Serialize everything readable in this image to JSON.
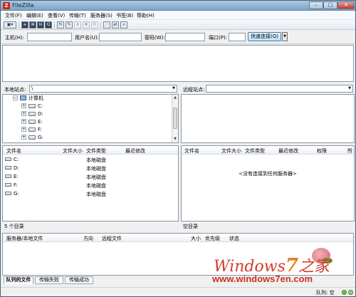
{
  "window": {
    "title": "FileZilla",
    "min": "–",
    "max": "□",
    "close": "✕",
    "app_icon": "Z"
  },
  "menu": [
    "文件(F)",
    "编辑(E)",
    "查看(V)",
    "传输(T)",
    "服务器(S)",
    "书签(B)",
    "帮助(H)"
  ],
  "toolbar": {
    "icons": [
      "site-manager-icon",
      "toggle-log-icon",
      "toggle-tree-local-icon",
      "toggle-tree-remote-icon",
      "toggle-queue-icon",
      "refresh-icon",
      "process-queue-icon",
      "cancel-icon",
      "disconnect-icon",
      "reconnect-icon",
      "filter-icon",
      "compare-icon",
      "search-icon"
    ]
  },
  "quickconnect": {
    "host_label": "主机(H):",
    "user_label": "用户名(U):",
    "pass_label": "密码(W):",
    "port_label": "端口(P):",
    "host_value": "",
    "user_value": "",
    "pass_value": "",
    "port_value": "",
    "connect_label": "快速连接(Q)",
    "dropdown": "▼"
  },
  "local": {
    "site_label": "本地站点:",
    "path": "\\",
    "tree_root": "计算机",
    "drives": [
      "C:",
      "D:",
      "E:",
      "F:",
      "G:"
    ],
    "columns": [
      "文件名",
      "文件大小",
      "文件类型",
      "最近修改"
    ],
    "rows": [
      {
        "name": "C:",
        "type": "本地磁盘"
      },
      {
        "name": "D:",
        "type": "本地磁盘"
      },
      {
        "name": "E:",
        "type": "本地磁盘"
      },
      {
        "name": "F:",
        "type": "本地磁盘"
      },
      {
        "name": "G:",
        "type": "本地磁盘"
      }
    ],
    "status": "5 个目录"
  },
  "remote": {
    "site_label": "远程站点:",
    "path": "",
    "columns": [
      "文件名",
      "文件大小",
      "文件类型",
      "最近修改",
      "权限",
      "所"
    ],
    "empty_message": "<没有连接到任何服务器>",
    "status": "空目录"
  },
  "queue": {
    "columns": [
      "服务器/本地文件",
      "方向",
      "远程文件",
      "大小",
      "优先级",
      "状态"
    ],
    "tabs": [
      "队列的文件",
      "传输失败",
      "传输成功"
    ],
    "status": "队列: 空"
  },
  "watermark": {
    "line1_a": "Windows",
    "line1_seven": "7",
    "line1_b": "之家",
    "url": "www.windows7en.com"
  }
}
